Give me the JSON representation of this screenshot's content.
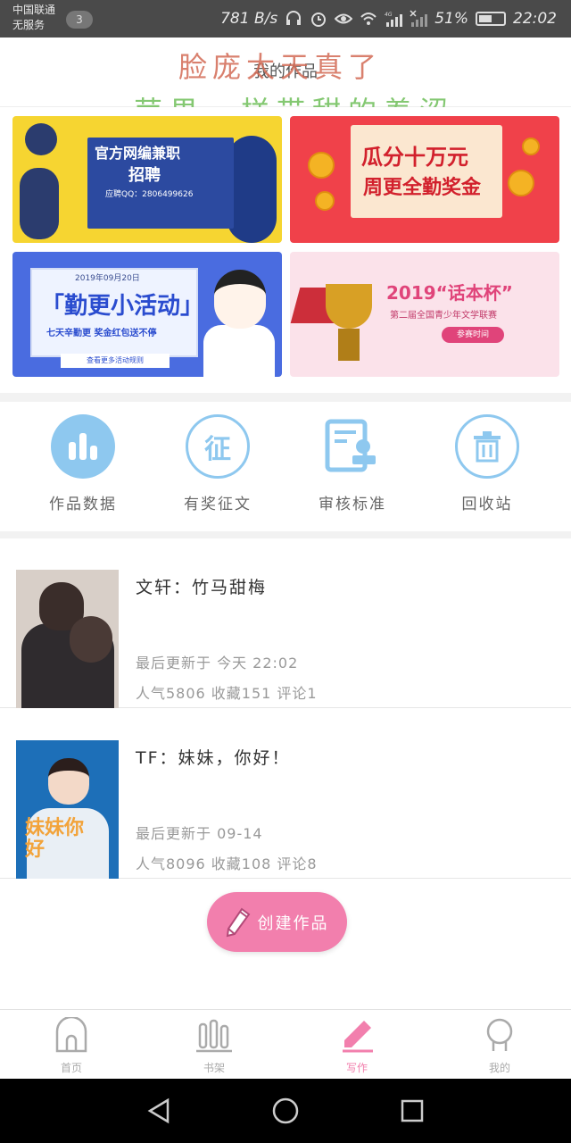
{
  "status_bar": {
    "carrier_line1": "中国联通",
    "carrier_line2": "无服务",
    "notification_count": "3",
    "net_speed": "781 B/s",
    "battery": "51%",
    "time": "22:02",
    "signal_label": "4G"
  },
  "header": {
    "title": "我的作品",
    "overlay_line1": "脸庞太天真了",
    "overlay_line2": "苹果一样带甜的羞涩"
  },
  "banners": [
    {
      "title": "官方网编兼职",
      "subtitle": "招聘",
      "detail": "应聘QQ：2806499626"
    },
    {
      "title": "瓜分十万元",
      "subtitle": "周更全勤奖金"
    },
    {
      "date": "2019年09月20日",
      "title": "「勤更小活动」",
      "subtitle": "七天辛勤更 奖金红包送不停",
      "button": "查看更多活动规则"
    },
    {
      "title": "2019“话本杯”",
      "subtitle": "第二届全国青少年文学联赛",
      "time_badge": "参赛时间"
    }
  ],
  "tools": [
    {
      "label": "作品数据",
      "icon": "bar-chart-icon"
    },
    {
      "label": "有奖征文",
      "icon": "zheng-icon",
      "icon_text": "征"
    },
    {
      "label": "审核标准",
      "icon": "document-stamp-icon"
    },
    {
      "label": "回收站",
      "icon": "trash-icon"
    }
  ],
  "works": [
    {
      "title": "文轩：竹马甜梅",
      "updated": "最后更新于 今天 22:02",
      "stats": "人气5806 收藏151 评论1"
    },
    {
      "title": "TF：妹妹，你好！",
      "cover_text": "妹妹你好",
      "updated": "最后更新于 09-14",
      "stats": "人气8096 收藏108 评论8"
    }
  ],
  "create_button": {
    "label": "创建作品"
  },
  "bottom_nav": [
    {
      "label": "首页",
      "icon": "home-icon"
    },
    {
      "label": "书架",
      "icon": "bookshelf-icon"
    },
    {
      "label": "写作",
      "icon": "pencil-icon",
      "active": true
    },
    {
      "label": "我的",
      "icon": "profile-icon"
    }
  ],
  "colors": {
    "accent_pink": "#f27fad",
    "tool_blue": "#8ec8ef",
    "status_bar": "#4a4a4a"
  }
}
